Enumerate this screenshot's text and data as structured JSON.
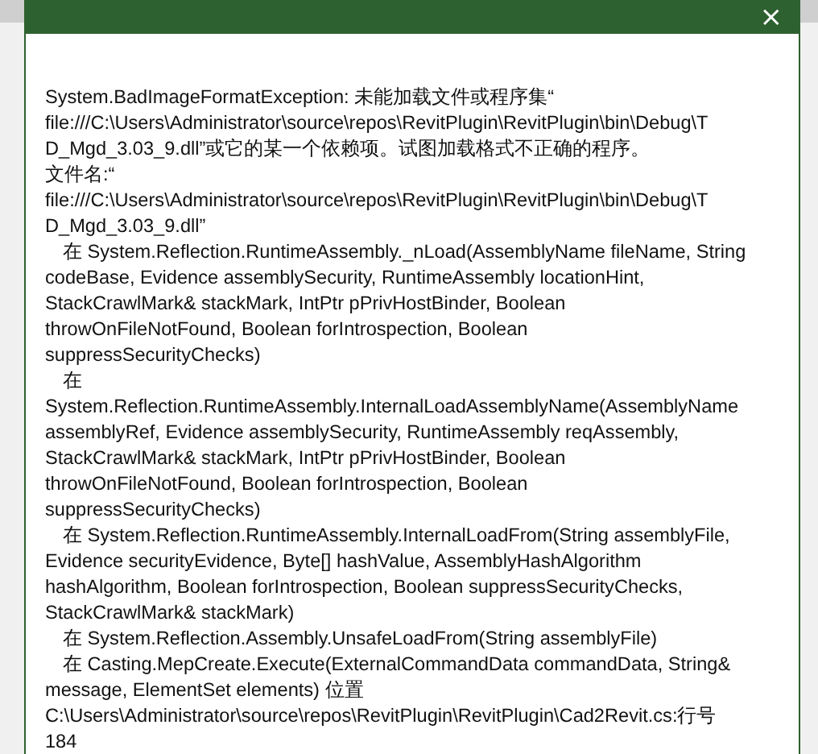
{
  "dialog": {
    "close_label": "×",
    "lines": [
      {
        "text": "System.BadImageFormatException: 未能加载文件或程序集“",
        "indent": false
      },
      {
        "text": "file:///C:\\Users\\Administrator\\source\\repos\\RevitPlugin\\RevitPlugin\\bin\\Debug\\T",
        "indent": false
      },
      {
        "text": "D_Mgd_3.03_9.dll”或它的某一个依赖项。试图加载格式不正确的程序。",
        "indent": false
      },
      {
        "text": "文件名:“",
        "indent": false
      },
      {
        "text": "file:///C:\\Users\\Administrator\\source\\repos\\RevitPlugin\\RevitPlugin\\bin\\Debug\\T",
        "indent": false
      },
      {
        "text": "D_Mgd_3.03_9.dll”",
        "indent": false
      },
      {
        "text": "在 System.Reflection.RuntimeAssembly._nLoad(AssemblyName fileName, String",
        "indent": true
      },
      {
        "text": "codeBase, Evidence assemblySecurity, RuntimeAssembly locationHint,",
        "indent": false
      },
      {
        "text": "StackCrawlMark& stackMark, IntPtr pPrivHostBinder, Boolean",
        "indent": false
      },
      {
        "text": "throwOnFileNotFound, Boolean forIntrospection, Boolean",
        "indent": false
      },
      {
        "text": "suppressSecurityChecks)",
        "indent": false
      },
      {
        "text": "在",
        "indent": true
      },
      {
        "text": "System.Reflection.RuntimeAssembly.InternalLoadAssemblyName(AssemblyName",
        "indent": false
      },
      {
        "text": "assemblyRef, Evidence assemblySecurity, RuntimeAssembly reqAssembly,",
        "indent": false
      },
      {
        "text": "StackCrawlMark& stackMark, IntPtr pPrivHostBinder, Boolean",
        "indent": false
      },
      {
        "text": "throwOnFileNotFound, Boolean forIntrospection, Boolean",
        "indent": false
      },
      {
        "text": "suppressSecurityChecks)",
        "indent": false
      },
      {
        "text": "在 System.Reflection.RuntimeAssembly.InternalLoadFrom(String assemblyFile,",
        "indent": true
      },
      {
        "text": "Evidence securityEvidence, Byte[] hashValue, AssemblyHashAlgorithm",
        "indent": false
      },
      {
        "text": "hashAlgorithm, Boolean forIntrospection, Boolean suppressSecurityChecks,",
        "indent": false
      },
      {
        "text": "StackCrawlMark& stackMark)",
        "indent": false
      },
      {
        "text": "在 System.Reflection.Assembly.UnsafeLoadFrom(String assemblyFile)",
        "indent": true
      },
      {
        "text": "在 Casting.MepCreate.Execute(ExternalCommandData commandData, String&",
        "indent": true
      },
      {
        "text": "message, ElementSet elements) 位置",
        "indent": false
      },
      {
        "text": "C:\\Users\\Administrator\\source\\repos\\RevitPlugin\\RevitPlugin\\Cad2Revit.cs:行号",
        "indent": false
      },
      {
        "text": "184",
        "indent": false
      }
    ]
  }
}
